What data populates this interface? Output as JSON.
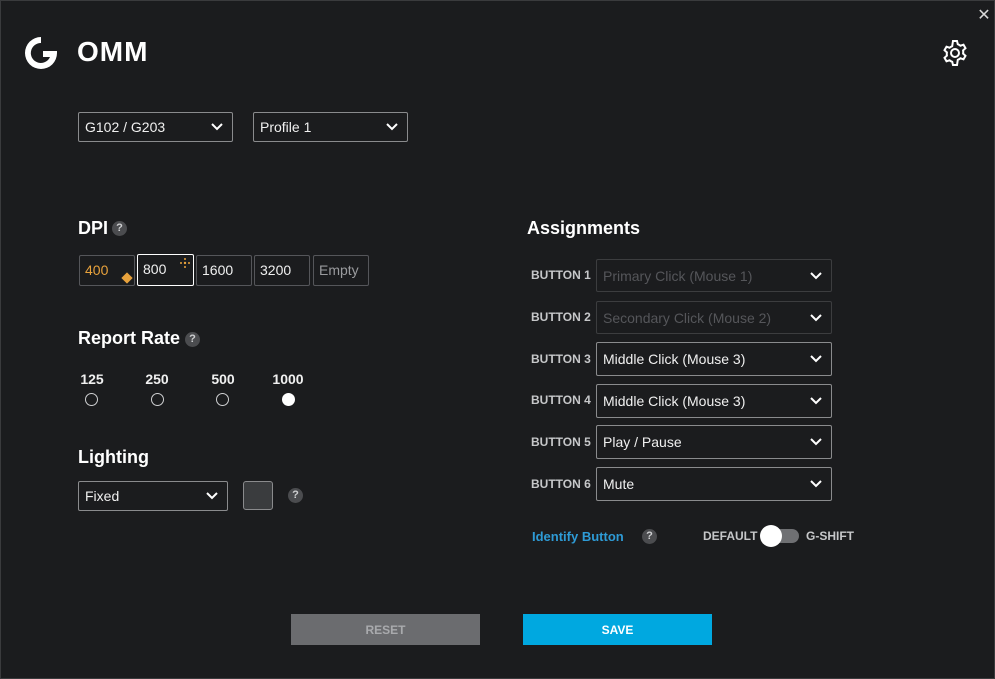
{
  "app": {
    "title": "OMM",
    "logo_icon": "logitech-g-logo-icon",
    "close_glyph": "✕"
  },
  "header": {
    "settings_icon": "gear-icon"
  },
  "device_select": {
    "value": "G102 / G203"
  },
  "profile_select": {
    "value": "Profile 1"
  },
  "dpi": {
    "title": "DPI",
    "help": "?",
    "levels": [
      "400",
      "800",
      "1600",
      "3200",
      "Empty"
    ],
    "default_level": "400",
    "current_level": "800"
  },
  "report_rate": {
    "title": "Report Rate",
    "help": "?",
    "options": [
      "125",
      "250",
      "500",
      "1000"
    ],
    "selected": "1000"
  },
  "lighting": {
    "title": "Lighting",
    "help": "?",
    "mode": "Fixed",
    "color": "#3a3c3e"
  },
  "assignments": {
    "title": "Assignments",
    "buttons": [
      {
        "label": "BUTTON 1",
        "value": "Primary Click (Mouse 1)",
        "disabled": true
      },
      {
        "label": "BUTTON 2",
        "value": "Secondary Click (Mouse 2)",
        "disabled": true
      },
      {
        "label": "BUTTON 3",
        "value": "Middle Click (Mouse 3)",
        "disabled": false
      },
      {
        "label": "BUTTON 4",
        "value": "Middle Click (Mouse 3)",
        "disabled": false
      },
      {
        "label": "BUTTON 5",
        "value": "Play / Pause",
        "disabled": false
      },
      {
        "label": "BUTTON 6",
        "value": "Mute",
        "disabled": false
      }
    ],
    "identify_label": "Identify Button",
    "identify_help": "?",
    "toggle_left": "DEFAULT",
    "toggle_right": "G-SHIFT",
    "toggle_state": "DEFAULT"
  },
  "footer": {
    "reset_label": "RESET",
    "save_label": "SAVE"
  },
  "colors": {
    "accent": "#00a8e0",
    "default_dpi": "#e8a23c",
    "link": "#2e9bd6",
    "background": "#1b1c1e"
  }
}
